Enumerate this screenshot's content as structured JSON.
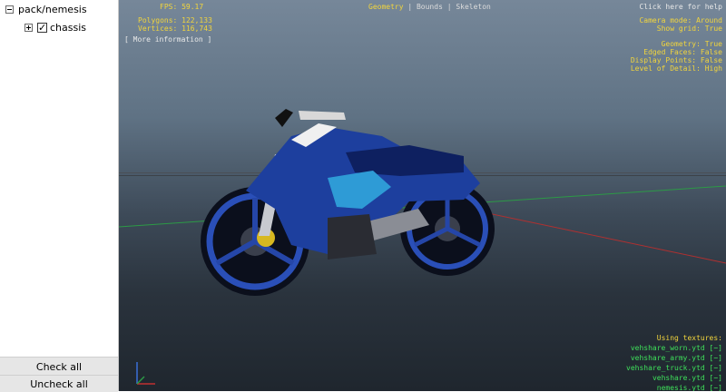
{
  "tree": {
    "root": {
      "label": "pack/nemesis"
    },
    "child": {
      "label": "chassis",
      "checked": true
    }
  },
  "buttons": {
    "check_all": "Check all",
    "uncheck_all": "Uncheck all"
  },
  "hud": {
    "fps": "FPS: 59.17",
    "polygons": "Polygons: 122,133",
    "vertices": "Vertices: 116,743",
    "more_info": "[ More information ]",
    "help": "Click here for help",
    "tabs": [
      "Geometry",
      "Bounds",
      "Skeleton"
    ],
    "camera_mode": "Camera mode: Around",
    "show_grid": "Show grid: True",
    "geometry": "Geometry: True",
    "edged_faces": "Edged Faces: False",
    "display_points": "Display Points: False",
    "lod": "Level of Detail: High",
    "using_textures": "Using textures:",
    "textures": [
      "vehshare_worn.ytd [−]",
      "vehshare_army.ytd [−]",
      "vehshare_truck.ytd [−]",
      "vehshare.ytd [−]",
      "nemesis.ytd [−]"
    ]
  },
  "colors": {
    "hud_yellow": "#f2d53c",
    "hud_green": "#3ee05a",
    "bike_blue": "#1d3f9e"
  }
}
